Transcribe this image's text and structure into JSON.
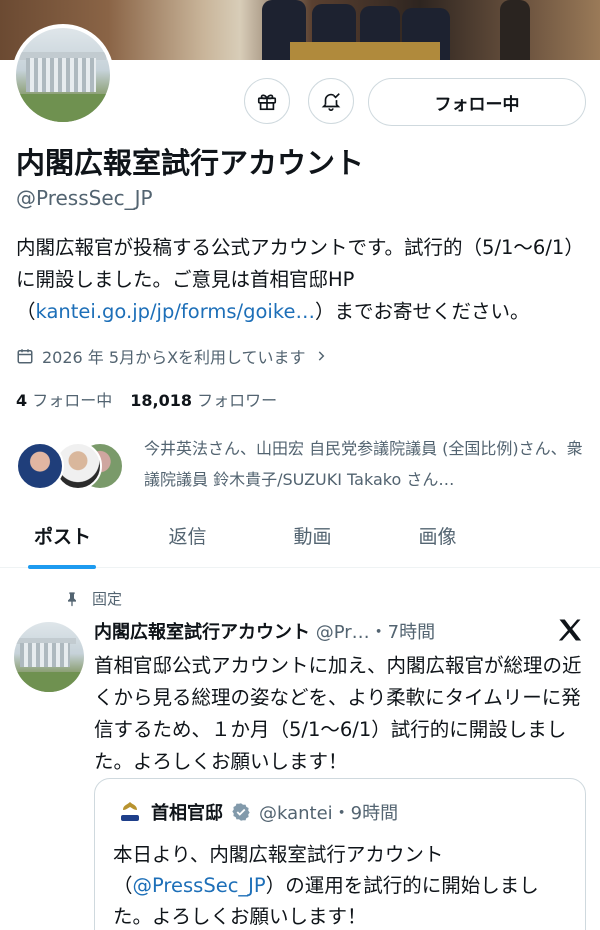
{
  "profile": {
    "name": "内閣広報室試行アカウント",
    "handle": "@PressSec_JP",
    "bio_text": "内閣広報官が投稿する公式アカウントです。試行的（5/1〜6/1）に開設しました。ご意見は首相官邸HP（",
    "bio_link": "kantei.go.jp/jp/forms/goike…",
    "bio_end": "）までお寄せください。",
    "joined": "2026 年 5月からXを利用しています",
    "following_count": "4",
    "following_label": "フォロー中",
    "followers_count": "18,018",
    "followers_label": "フォロワー",
    "followed_by": "今井英法さん、山田宏 自民党参議院議員 (全国比例)さん、衆議院議員 鈴木貴子/SUZUKI Takako さん…"
  },
  "actions": {
    "follow_button": "フォロー中",
    "gift_icon": "gift-icon",
    "notify_icon": "bell-check-icon"
  },
  "tabs": [
    {
      "label": "ポスト"
    },
    {
      "label": "返信"
    },
    {
      "label": "動画"
    },
    {
      "label": "画像"
    }
  ],
  "pinned_post": {
    "pinned_label": "固定",
    "author": "内閣広報室試行アカウント",
    "handle_time": "@Pr…・7時間",
    "text": "首相官邸公式アカウントに加え、内閣広報官が総理の近くから見る総理の姿などを、より柔軟にタイムリーに発信するため、１か月（5/1〜6/1）試行的に開設しました。よろしくお願いします！",
    "quote": {
      "author": "首相官邸",
      "handle_time": "@kantei・9時間",
      "text_start": "本日より、内閣広報室試行アカウント（",
      "mention": "@PressSec_JP",
      "text_end": "）の運用を試行的に開始しました。よろしくお願いします！"
    }
  },
  "colors": {
    "accent": "#1d9bf0",
    "link": "#1d6fb8",
    "secondary_text": "#536471",
    "verified": "#829aab"
  }
}
